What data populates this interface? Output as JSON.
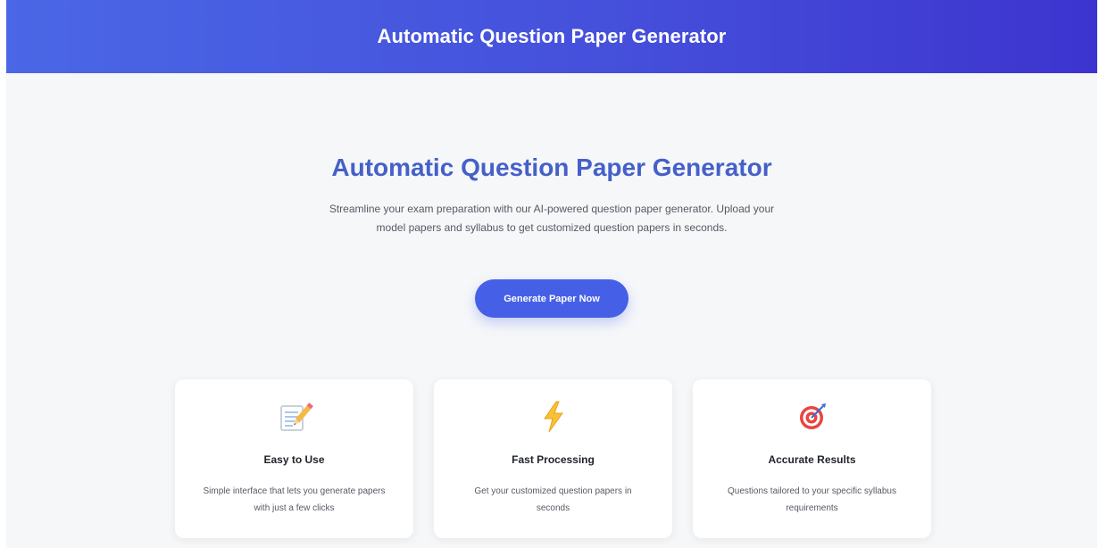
{
  "header": {
    "title": "Automatic Question Paper Generator"
  },
  "hero": {
    "title": "Automatic Question Paper Generator",
    "description": "Streamline your exam preparation with our AI-powered question paper generator. Upload your model papers and syllabus to get customized question papers in seconds.",
    "cta_label": "Generate Paper Now"
  },
  "features": [
    {
      "icon": "memo-pencil-icon",
      "title": "Easy to Use",
      "description": "Simple interface that lets you generate papers with just a few clicks"
    },
    {
      "icon": "lightning-icon",
      "title": "Fast Processing",
      "description": "Get your customized question papers in seconds"
    },
    {
      "icon": "target-icon",
      "title": "Accurate Results",
      "description": "Questions tailored to your specific syllabus requirements"
    }
  ],
  "colors": {
    "header_gradient_start": "#4a67e6",
    "header_gradient_end": "#3d34cf",
    "accent": "#4560c9",
    "button": "#4560e6",
    "background": "#f6f7f9"
  }
}
